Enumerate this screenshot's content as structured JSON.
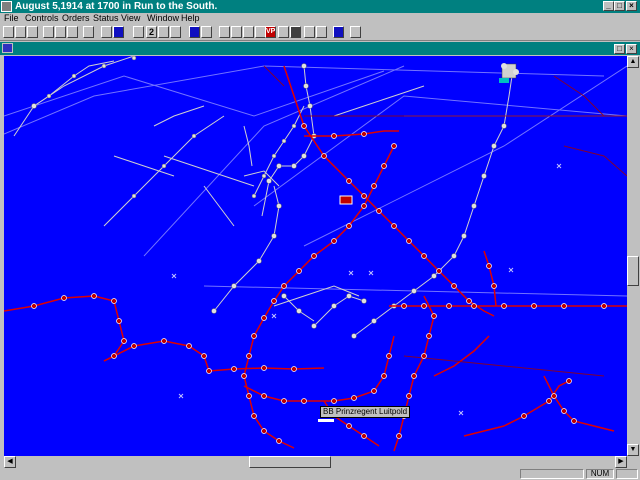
{
  "window": {
    "title": "August 5,1914 at 1700 in Run to the South."
  },
  "menu": [
    "File",
    "Controls",
    "Orders",
    "Status",
    "View",
    "Window",
    "Help"
  ],
  "toolbar": {
    "buttons": [
      "new",
      "open",
      "save",
      "print",
      "cut",
      "copy",
      "help-question",
      "unit-view",
      "ship-info",
      "number-2",
      "weather",
      "task-force",
      "map",
      "zoom",
      "zoom-out",
      "hex-grid",
      "range",
      "arrange",
      "vp-button",
      "target",
      "chart",
      "report",
      "log",
      "window-layout",
      "speaker"
    ],
    "vp_label": "VP",
    "two_label": "2"
  },
  "map": {
    "ship_label": "BB Prinzregent Luitpold",
    "colors": {
      "sea": "#0000ff",
      "british_tracks": "#d0d0d0",
      "german_tracks": "#e00000"
    }
  },
  "status": {
    "num_indicator": "NUM"
  }
}
